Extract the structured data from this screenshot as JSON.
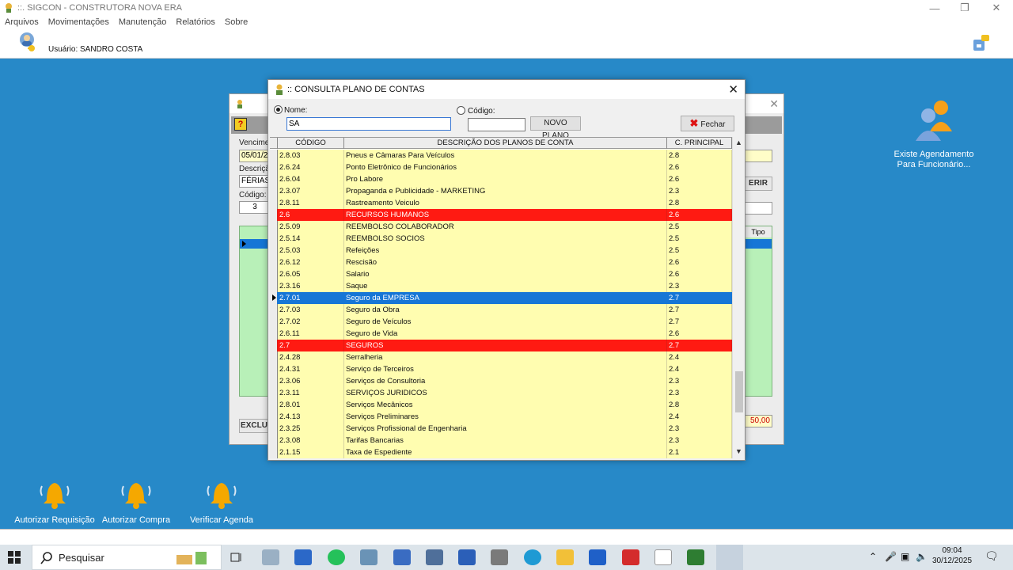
{
  "window": {
    "title": "::. SIGCON - CONSTRUTORA NOVA ERA"
  },
  "menu": [
    "Arquivos",
    "Movimentações",
    "Manutenção",
    "Relatórios",
    "Sobre"
  ],
  "user": {
    "label": "Usuário: SANDRO COSTA"
  },
  "background_form": {
    "labels": {
      "vencimento": "Vencimen",
      "descricao": "Descriçã",
      "codigo": "Código:",
      "tipo": "Tipo"
    },
    "values": {
      "vencimento": "05/01/20",
      "descricao": "FÉRIAS",
      "codigo": "3",
      "valor": "50,00"
    },
    "buttons": {
      "inserir": "ERIR",
      "excluir": "EXCLU"
    }
  },
  "dialog": {
    "title": ":: CONSULTA PLANO DE CONTAS",
    "nome_label": "Nome:",
    "nome_value": "SA",
    "codigo_label": "Código:",
    "codigo_value": "",
    "novo_plano_button": "NOVO PLANO",
    "fechar_button": "Fechar",
    "columns": [
      "CÓDIGO",
      "DESCRIÇÃO DOS PLANOS DE CONTA",
      "C. PRINCIPAL"
    ],
    "rows": [
      {
        "codigo": "2.8.03",
        "descricao": "Pneus e Câmaras Para Veículos",
        "principal": "2.8",
        "style": "normal"
      },
      {
        "codigo": "2.6.24",
        "descricao": "Ponto Eletrônico de Funcionários",
        "principal": "2.6",
        "style": "normal"
      },
      {
        "codigo": "2.6.04",
        "descricao": "Pro Labore",
        "principal": "2.6",
        "style": "normal"
      },
      {
        "codigo": "2.3.07",
        "descricao": "Propaganda e Publicidade - MARKETING",
        "principal": "2.3",
        "style": "normal"
      },
      {
        "codigo": "2.8.11",
        "descricao": "Rastreamento Veiculo",
        "principal": "2.8",
        "style": "normal"
      },
      {
        "codigo": "2.6",
        "descricao": "RECURSOS HUMANOS",
        "principal": "2.6",
        "style": "red"
      },
      {
        "codigo": "2.5.09",
        "descricao": "REEMBOLSO COLABORADOR",
        "principal": "2.5",
        "style": "normal"
      },
      {
        "codigo": "2.5.14",
        "descricao": "REEMBOLSO SOCIOS",
        "principal": "2.5",
        "style": "normal"
      },
      {
        "codigo": "2.5.03",
        "descricao": "Refeições",
        "principal": "2.5",
        "style": "normal"
      },
      {
        "codigo": "2.6.12",
        "descricao": "Rescisão",
        "principal": "2.6",
        "style": "normal"
      },
      {
        "codigo": "2.6.05",
        "descricao": "Salario",
        "principal": "2.6",
        "style": "normal"
      },
      {
        "codigo": "2.3.16",
        "descricao": "Saque",
        "principal": "2.3",
        "style": "normal"
      },
      {
        "codigo": "2.7.01",
        "descricao": "Seguro da EMPRESA",
        "principal": "2.7",
        "style": "selected"
      },
      {
        "codigo": "2.7.03",
        "descricao": "Seguro da Obra",
        "principal": "2.7",
        "style": "normal"
      },
      {
        "codigo": "2.7.02",
        "descricao": "Seguro de Veículos",
        "principal": "2.7",
        "style": "normal"
      },
      {
        "codigo": "2.6.11",
        "descricao": "Seguro de Vida",
        "principal": "2.6",
        "style": "normal"
      },
      {
        "codigo": "2.7",
        "descricao": "SEGUROS",
        "principal": "2.7",
        "style": "red"
      },
      {
        "codigo": "2.4.28",
        "descricao": "Serralheria",
        "principal": "2.4",
        "style": "normal"
      },
      {
        "codigo": "2.4.31",
        "descricao": "Serviço de Terceiros",
        "principal": "2.4",
        "style": "normal"
      },
      {
        "codigo": "2.3.06",
        "descricao": "Serviços de Consultoria",
        "principal": "2.3",
        "style": "normal"
      },
      {
        "codigo": "2.3.11",
        "descricao": "SERVIÇOS JURIDICOS",
        "principal": "2.3",
        "style": "normal"
      },
      {
        "codigo": "2.8.01",
        "descricao": "Serviços Mecânicos",
        "principal": "2.8",
        "style": "normal"
      },
      {
        "codigo": "2.4.13",
        "descricao": "Serviços Preliminares",
        "principal": "2.4",
        "style": "normal"
      },
      {
        "codigo": "2.3.25",
        "descricao": "Serviços Profissional de Engenharia",
        "principal": "2.3",
        "style": "normal"
      },
      {
        "codigo": "2.3.08",
        "descricao": "Tarifas Bancarias",
        "principal": "2.3",
        "style": "normal"
      },
      {
        "codigo": "2.1.15",
        "descricao": "Taxa de Espediente",
        "principal": "2.1",
        "style": "normal"
      }
    ]
  },
  "desktop": {
    "notification": "Existe Agendamento Para Funcionário...",
    "icons": [
      "Autorizar Requisição",
      "Autorizar Compra",
      "Verificar Agenda"
    ]
  },
  "taskbar": {
    "search_placeholder": "Pesquisar",
    "time": "09:04",
    "date": "30/12/2025"
  },
  "colors": {
    "desktop": "#2789c8",
    "row_yellow": "#fffdb0",
    "row_red": "#ff1a12",
    "row_selected": "#1676d6"
  }
}
